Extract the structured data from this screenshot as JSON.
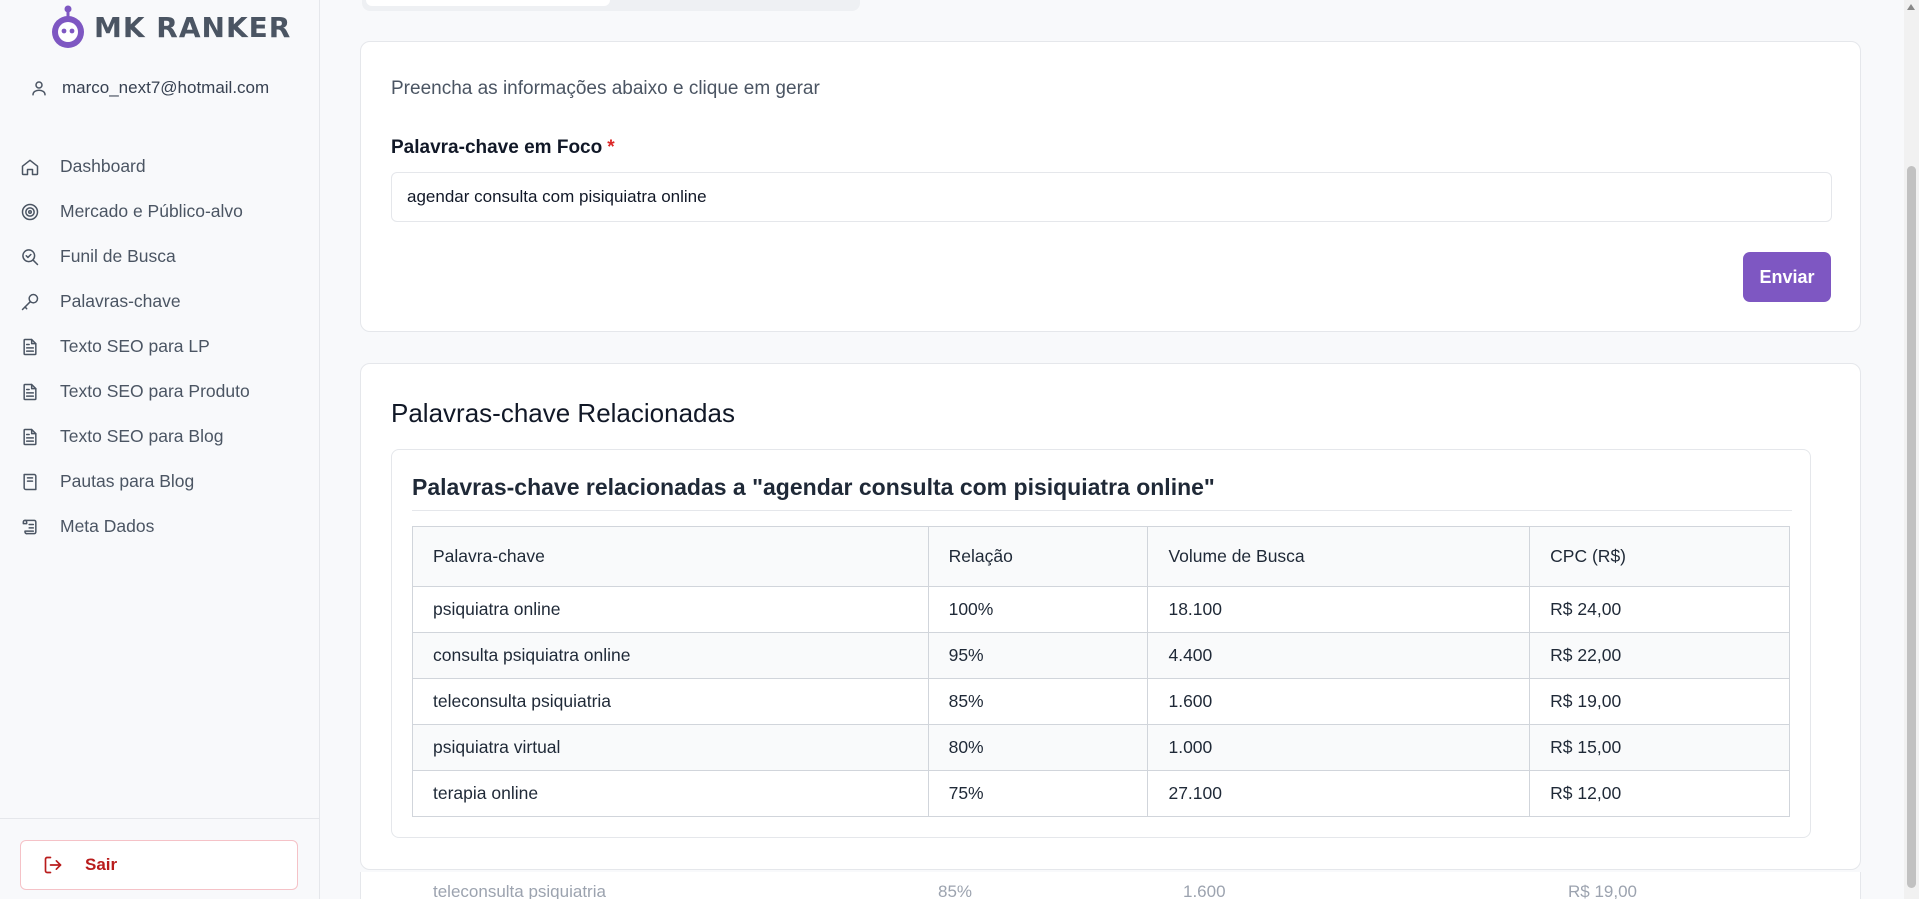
{
  "brand": {
    "name": "MK RANKER",
    "accent": "#7e57c2"
  },
  "user": {
    "email": "marco_next7@hotmail.com"
  },
  "nav": [
    {
      "label": "Dashboard",
      "icon": "home-icon"
    },
    {
      "label": "Mercado e Público-alvo",
      "icon": "target-icon"
    },
    {
      "label": "Funil de Busca",
      "icon": "search-check-icon"
    },
    {
      "label": "Palavras-chave",
      "icon": "key-icon"
    },
    {
      "label": "Texto SEO para LP",
      "icon": "document-icon"
    },
    {
      "label": "Texto SEO para Produto",
      "icon": "document-icon"
    },
    {
      "label": "Texto SEO para Blog",
      "icon": "document-icon"
    },
    {
      "label": "Pautas para Blog",
      "icon": "book-icon"
    },
    {
      "label": "Meta Dados",
      "icon": "scroll-icon"
    }
  ],
  "logout": {
    "label": "Sair",
    "color": "#b91c1c"
  },
  "form": {
    "intro": "Preencha as informações abaixo e clique em gerar",
    "field_label": "Palavra-chave em Foco",
    "required_mark": "*",
    "field_value": "agendar consulta com pisiquiatra online",
    "submit_label": "Enviar"
  },
  "results": {
    "title": "Palavras-chave Relacionadas",
    "subtitle": "Palavras-chave relacionadas a \"agendar consulta com pisiquiatra online\"",
    "columns": [
      "Palavra-chave",
      "Relação",
      "Volume de Busca",
      "CPC (R$)"
    ],
    "rows": [
      [
        "psiquiatra online",
        "100%",
        "18.100",
        "R$ 24,00"
      ],
      [
        "consulta psiquiatra online",
        "95%",
        "4.400",
        "R$ 22,00"
      ],
      [
        "teleconsulta psiquiatria",
        "85%",
        "1.600",
        "R$ 19,00"
      ],
      [
        "psiquiatra virtual",
        "80%",
        "1.000",
        "R$ 15,00"
      ],
      [
        "terapia online",
        "75%",
        "27.100",
        "R$ 12,00"
      ]
    ]
  }
}
